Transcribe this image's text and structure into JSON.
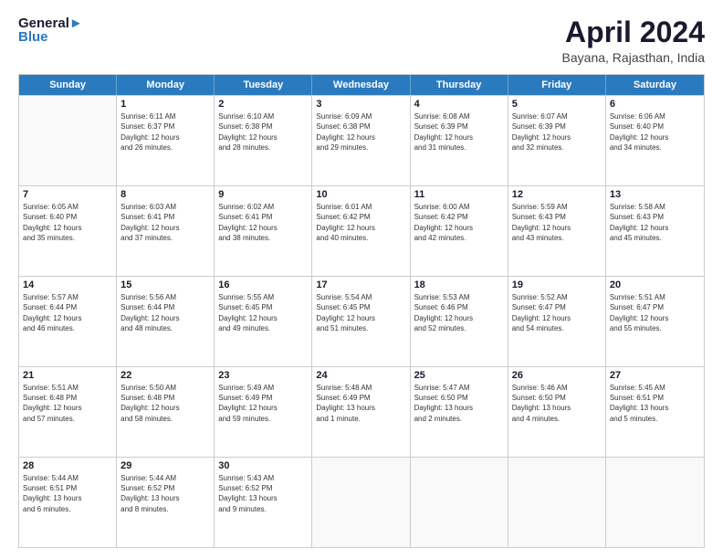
{
  "logo": {
    "line1": "General",
    "line2": "Blue"
  },
  "title": "April 2024",
  "subtitle": "Bayana, Rajasthan, India",
  "weekdays": [
    "Sunday",
    "Monday",
    "Tuesday",
    "Wednesday",
    "Thursday",
    "Friday",
    "Saturday"
  ],
  "rows": [
    [
      {
        "day": "",
        "info": ""
      },
      {
        "day": "1",
        "info": "Sunrise: 6:11 AM\nSunset: 6:37 PM\nDaylight: 12 hours\nand 26 minutes."
      },
      {
        "day": "2",
        "info": "Sunrise: 6:10 AM\nSunset: 6:38 PM\nDaylight: 12 hours\nand 28 minutes."
      },
      {
        "day": "3",
        "info": "Sunrise: 6:09 AM\nSunset: 6:38 PM\nDaylight: 12 hours\nand 29 minutes."
      },
      {
        "day": "4",
        "info": "Sunrise: 6:08 AM\nSunset: 6:39 PM\nDaylight: 12 hours\nand 31 minutes."
      },
      {
        "day": "5",
        "info": "Sunrise: 6:07 AM\nSunset: 6:39 PM\nDaylight: 12 hours\nand 32 minutes."
      },
      {
        "day": "6",
        "info": "Sunrise: 6:06 AM\nSunset: 6:40 PM\nDaylight: 12 hours\nand 34 minutes."
      }
    ],
    [
      {
        "day": "7",
        "info": "Sunrise: 6:05 AM\nSunset: 6:40 PM\nDaylight: 12 hours\nand 35 minutes."
      },
      {
        "day": "8",
        "info": "Sunrise: 6:03 AM\nSunset: 6:41 PM\nDaylight: 12 hours\nand 37 minutes."
      },
      {
        "day": "9",
        "info": "Sunrise: 6:02 AM\nSunset: 6:41 PM\nDaylight: 12 hours\nand 38 minutes."
      },
      {
        "day": "10",
        "info": "Sunrise: 6:01 AM\nSunset: 6:42 PM\nDaylight: 12 hours\nand 40 minutes."
      },
      {
        "day": "11",
        "info": "Sunrise: 6:00 AM\nSunset: 6:42 PM\nDaylight: 12 hours\nand 42 minutes."
      },
      {
        "day": "12",
        "info": "Sunrise: 5:59 AM\nSunset: 6:43 PM\nDaylight: 12 hours\nand 43 minutes."
      },
      {
        "day": "13",
        "info": "Sunrise: 5:58 AM\nSunset: 6:43 PM\nDaylight: 12 hours\nand 45 minutes."
      }
    ],
    [
      {
        "day": "14",
        "info": "Sunrise: 5:57 AM\nSunset: 6:44 PM\nDaylight: 12 hours\nand 46 minutes."
      },
      {
        "day": "15",
        "info": "Sunrise: 5:56 AM\nSunset: 6:44 PM\nDaylight: 12 hours\nand 48 minutes."
      },
      {
        "day": "16",
        "info": "Sunrise: 5:55 AM\nSunset: 6:45 PM\nDaylight: 12 hours\nand 49 minutes."
      },
      {
        "day": "17",
        "info": "Sunrise: 5:54 AM\nSunset: 6:45 PM\nDaylight: 12 hours\nand 51 minutes."
      },
      {
        "day": "18",
        "info": "Sunrise: 5:53 AM\nSunset: 6:46 PM\nDaylight: 12 hours\nand 52 minutes."
      },
      {
        "day": "19",
        "info": "Sunrise: 5:52 AM\nSunset: 6:47 PM\nDaylight: 12 hours\nand 54 minutes."
      },
      {
        "day": "20",
        "info": "Sunrise: 5:51 AM\nSunset: 6:47 PM\nDaylight: 12 hours\nand 55 minutes."
      }
    ],
    [
      {
        "day": "21",
        "info": "Sunrise: 5:51 AM\nSunset: 6:48 PM\nDaylight: 12 hours\nand 57 minutes."
      },
      {
        "day": "22",
        "info": "Sunrise: 5:50 AM\nSunset: 6:48 PM\nDaylight: 12 hours\nand 58 minutes."
      },
      {
        "day": "23",
        "info": "Sunrise: 5:49 AM\nSunset: 6:49 PM\nDaylight: 12 hours\nand 59 minutes."
      },
      {
        "day": "24",
        "info": "Sunrise: 5:48 AM\nSunset: 6:49 PM\nDaylight: 13 hours\nand 1 minute."
      },
      {
        "day": "25",
        "info": "Sunrise: 5:47 AM\nSunset: 6:50 PM\nDaylight: 13 hours\nand 2 minutes."
      },
      {
        "day": "26",
        "info": "Sunrise: 5:46 AM\nSunset: 6:50 PM\nDaylight: 13 hours\nand 4 minutes."
      },
      {
        "day": "27",
        "info": "Sunrise: 5:45 AM\nSunset: 6:51 PM\nDaylight: 13 hours\nand 5 minutes."
      }
    ],
    [
      {
        "day": "28",
        "info": "Sunrise: 5:44 AM\nSunset: 6:51 PM\nDaylight: 13 hours\nand 6 minutes."
      },
      {
        "day": "29",
        "info": "Sunrise: 5:44 AM\nSunset: 6:52 PM\nDaylight: 13 hours\nand 8 minutes."
      },
      {
        "day": "30",
        "info": "Sunrise: 5:43 AM\nSunset: 6:52 PM\nDaylight: 13 hours\nand 9 minutes."
      },
      {
        "day": "",
        "info": ""
      },
      {
        "day": "",
        "info": ""
      },
      {
        "day": "",
        "info": ""
      },
      {
        "day": "",
        "info": ""
      }
    ]
  ]
}
